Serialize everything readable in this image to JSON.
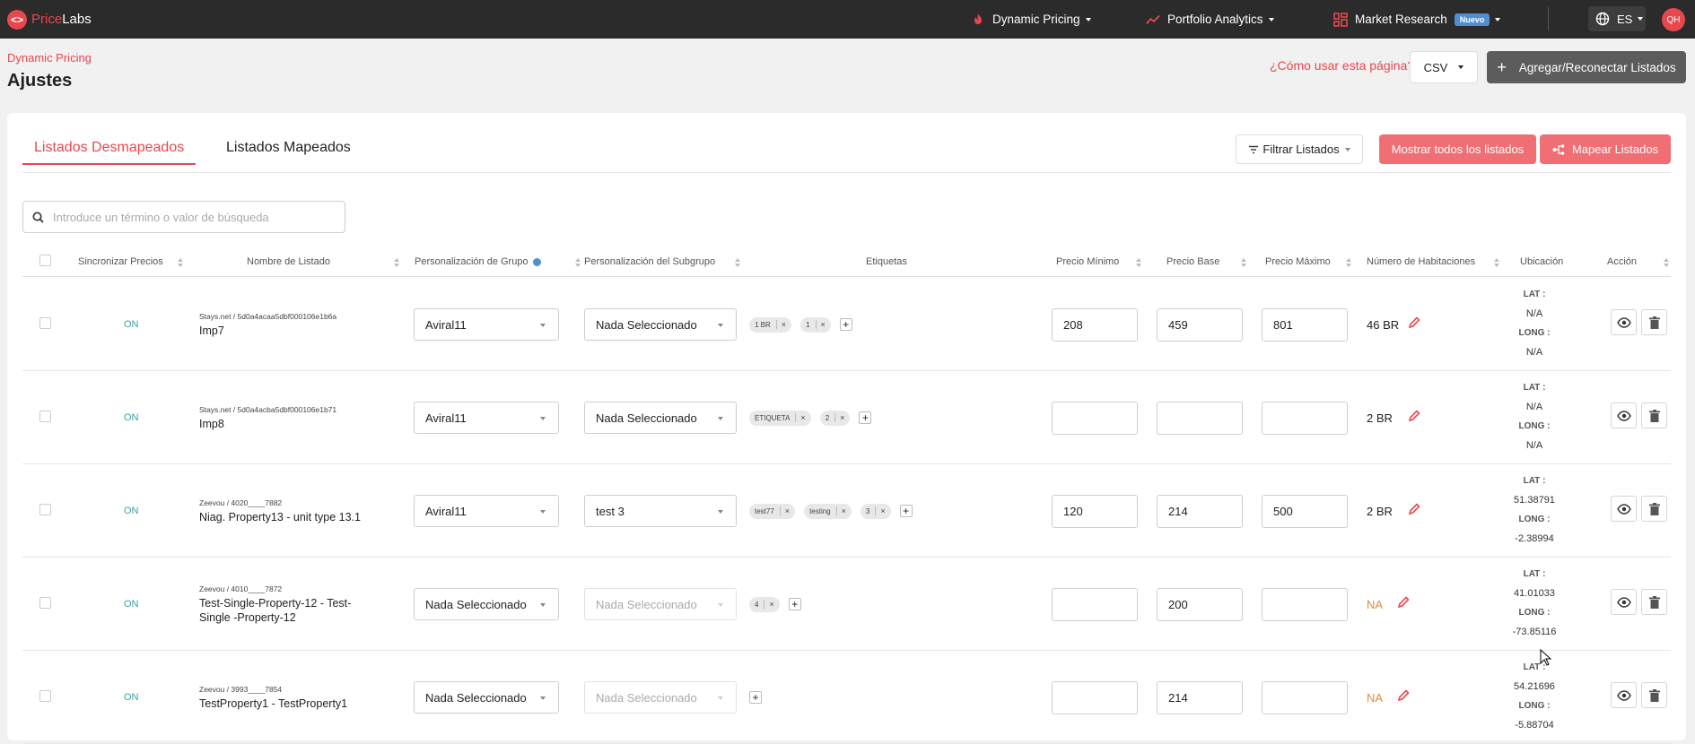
{
  "topbar": {
    "logo_mark": "<>",
    "logo_price": "Price",
    "logo_labs": "Labs",
    "nav": [
      {
        "label": "Dynamic Pricing",
        "icon": "fire-icon"
      },
      {
        "label": "Portfolio Analytics",
        "icon": "trend-icon"
      },
      {
        "label": "Market Research",
        "icon": "grid-icon",
        "badge": "Nuevo"
      }
    ],
    "language": "ES",
    "avatar": "QH"
  },
  "header": {
    "breadcrumb": "Dynamic Pricing",
    "title": "Ajustes",
    "help_link": "¿Cómo usar esta página?",
    "csv_label": "CSV",
    "add_button": "Agregar/Reconectar Listados"
  },
  "tabs": {
    "unmapped": "Listados Desmapeados",
    "mapped": "Listados Mapeados"
  },
  "toolbar": {
    "filter": "Filtrar Listados",
    "show_all": "Mostrar todos los listados",
    "map": "Mapear Listados"
  },
  "search": {
    "placeholder": "Introduce un término o valor de búsqueda"
  },
  "columns": {
    "sync": "Sincronizar Precios",
    "name": "Nombre de Listado",
    "group": "Personalización de Grupo",
    "subgroup": "Personalización del Subgrupo",
    "tags": "Etiquetas",
    "min": "Precio Mínimo",
    "base": "Precio Base",
    "max": "Precio Máximo",
    "rooms": "Número de Habitaciones",
    "location": "Ubicación",
    "action": "Acción"
  },
  "location_labels": {
    "lat": "LAT :",
    "long": "LONG :"
  },
  "rows": [
    {
      "sync": "ON",
      "source": "Stays.net / 5d0a4acaa5dbf000106e1b6a",
      "name": "Imp7",
      "group": "Aviral11",
      "subgroup": "Nada Seleccionado",
      "subgroup_disabled": false,
      "tags": [
        "1 BR",
        "1"
      ],
      "min": "208",
      "base": "459",
      "max": "801",
      "rooms": "46 BR",
      "rooms_na": false,
      "lat": "N/A",
      "long": "N/A"
    },
    {
      "sync": "ON",
      "source": "Stays.net / 5d0a4acba5dbf000106e1b71",
      "name": "Imp8",
      "group": "Aviral11",
      "subgroup": "Nada Seleccionado",
      "subgroup_disabled": false,
      "tags": [
        "ETIQUETA",
        "2"
      ],
      "min": "",
      "base": "",
      "max": "",
      "rooms": "2 BR",
      "rooms_na": false,
      "lat": "N/A",
      "long": "N/A"
    },
    {
      "sync": "ON",
      "source": "Zeevou / 4020____7882",
      "name": "Niag. Property13 - unit type 13.1",
      "group": "Aviral11",
      "subgroup": "test 3",
      "subgroup_disabled": false,
      "tags": [
        "test77",
        "testing",
        "3"
      ],
      "min": "120",
      "base": "214",
      "max": "500",
      "rooms": "2 BR",
      "rooms_na": false,
      "lat": "51.38791",
      "long": "-2.38994"
    },
    {
      "sync": "ON",
      "source": "Zeevou / 4010____7872",
      "name": "Test-Single-Property-12 - Test-Single -Property-12",
      "group": "Nada Seleccionado",
      "subgroup": "Nada Seleccionado",
      "subgroup_disabled": true,
      "tags": [
        "4"
      ],
      "min": "",
      "base": "200",
      "max": "",
      "rooms": "NA",
      "rooms_na": true,
      "lat": "41.01033",
      "long": "-73.85116"
    },
    {
      "sync": "ON",
      "source": "Zeevou / 3993____7854",
      "name": "TestProperty1 - TestProperty1",
      "group": "Nada Seleccionado",
      "subgroup": "Nada Seleccionado",
      "subgroup_disabled": true,
      "tags": [],
      "min": "",
      "base": "214",
      "max": "",
      "rooms": "NA",
      "rooms_na": true,
      "lat": "54.21696",
      "long": "-5.88704"
    }
  ],
  "colors": {
    "accent": "#e8474e",
    "button": "#ef6f74",
    "on": "#3aa0a6",
    "na": "#e48a3a"
  }
}
